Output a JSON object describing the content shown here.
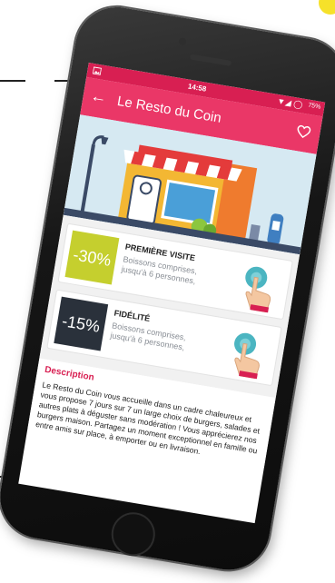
{
  "status_bar": {
    "time": "14:58",
    "battery": "75%"
  },
  "app_bar": {
    "title": "Le Resto du Coin",
    "back_icon": "arrow-left-icon",
    "favorite_icon": "heart-outline-icon"
  },
  "offers": [
    {
      "discount": "-30%",
      "title": "PREMIÈRE VISITE",
      "line1": "Boissons comprises,",
      "line2": "jusqu'à 6 personnes,"
    },
    {
      "discount": "-15%",
      "title": "FIDÉLITÉ",
      "line1": "Boissons comprises,",
      "line2": "jusqu'à 6 personnes,"
    }
  ],
  "description": {
    "title": "Description",
    "text": "Le Resto du Coin vous accueille dans un cadre chaleureux et vous propose 7 jours sur 7 un large choix de burgers, salades et autres plats à déguster sans modération ! Vous apprécierez nos burgers maison. Partagez un moment exceptionnel en famille ou entre amis sur place, à emporter ou en livraison."
  },
  "colors": {
    "primary": "#ea3767",
    "primary_dark": "#d81f52",
    "offer_green": "#c5cf2e",
    "offer_dark": "#2a313b"
  }
}
